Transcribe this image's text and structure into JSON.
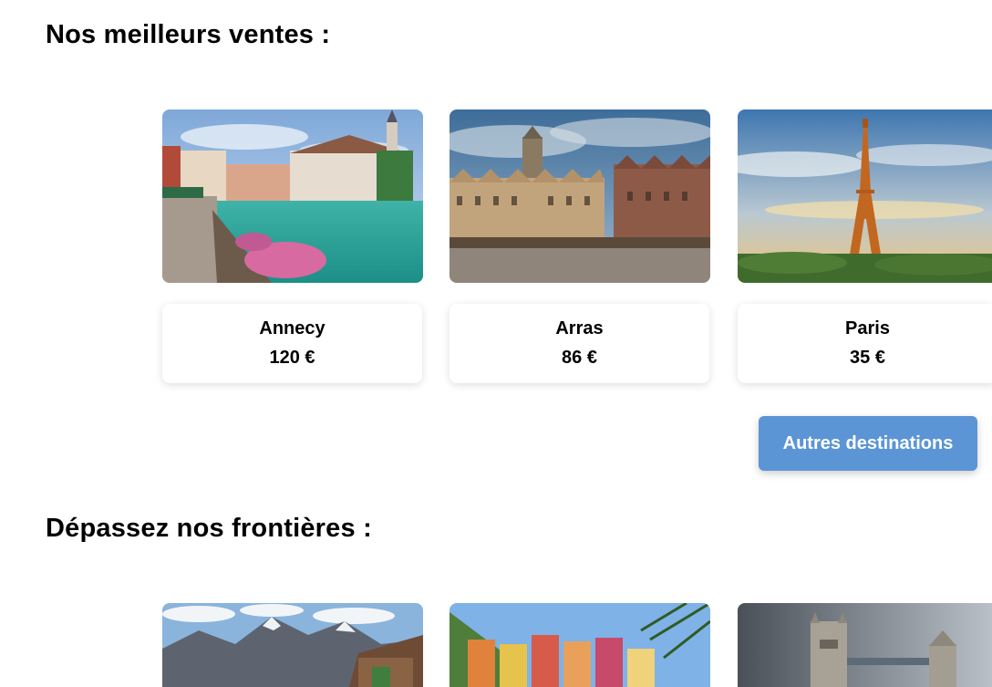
{
  "bestsellers": {
    "title": "Nos meilleurs ventes :",
    "cards": [
      {
        "city": "Annecy",
        "price": "120 €"
      },
      {
        "city": "Arras",
        "price": "86 €"
      },
      {
        "city": "Paris",
        "price": "35 €"
      }
    ],
    "more_button_label": "Autres destinations"
  },
  "abroad": {
    "title": "Dépassez nos frontières :"
  }
}
